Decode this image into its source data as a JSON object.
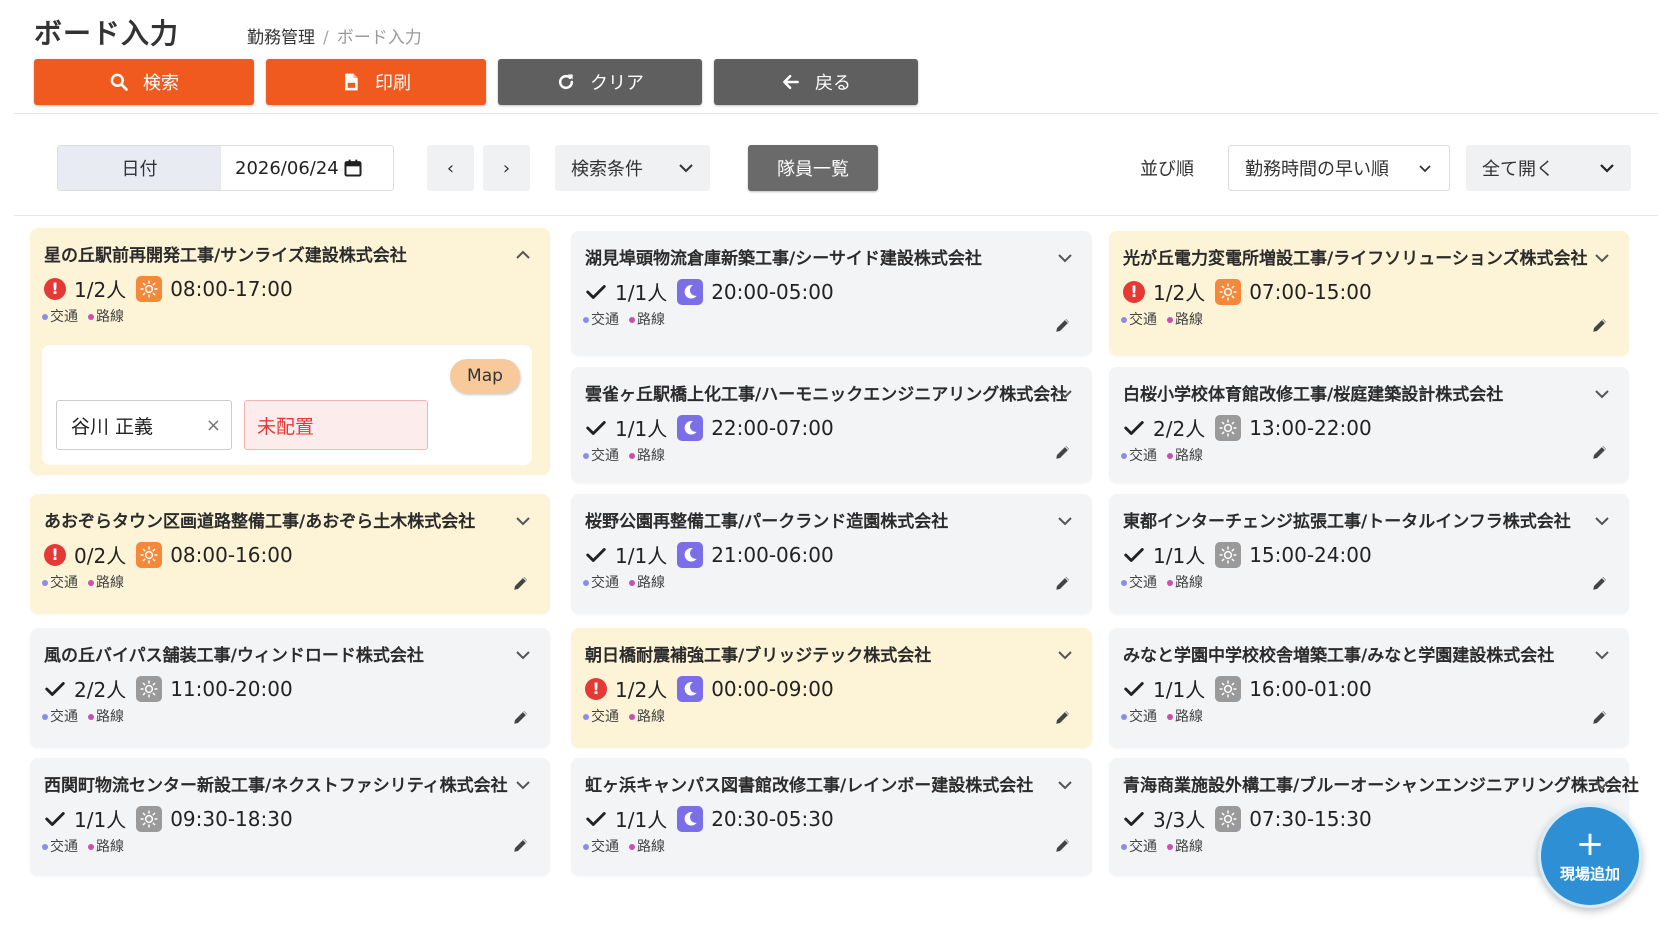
{
  "header": {
    "title": "ボード入力",
    "breadcrumb": [
      "勤務管理",
      "ボード入力"
    ],
    "separator": "/"
  },
  "toolbar": {
    "search": "検索",
    "print": "印刷",
    "clear": "クリア",
    "back": "戻る"
  },
  "filters": {
    "date_label": "日付",
    "date_value": "2026/06/24",
    "prev": "‹",
    "next": "›",
    "search_conditions": "検索条件",
    "members_list": "隊員一覧",
    "sort_label": "並び順",
    "sort_value": "勤務時間の早い順",
    "expand_value": "全て開く"
  },
  "tags": {
    "traffic": "交通",
    "route": "路線"
  },
  "colors": {
    "accent_orange": "#f15a1f",
    "warn_bg": "#fdf3d6",
    "alert": "#e53935",
    "sun": "#f5893b",
    "moon": "#7b6ee6",
    "fab": "#2f8fd4"
  },
  "detail": {
    "map": "Map",
    "assignee": "谷川 正義",
    "remove": "×",
    "unassigned": "未配置"
  },
  "cards": [
    {
      "title": "星の丘駅前再開発工事/サンライズ建設株式会社",
      "count": "1/2人",
      "time": "08:00-17:00",
      "status": "alert",
      "shift": "sun",
      "expanded": true
    },
    {
      "title": "湖見埠頭物流倉庫新築工事/シーサイド建設株式会社",
      "count": "1/1人",
      "time": "20:00-05:00",
      "status": "ok",
      "shift": "moon"
    },
    {
      "title": "光が丘電力変電所増設工事/ライフソリューションズ株式会社",
      "count": "1/2人",
      "time": "07:00-15:00",
      "status": "alert",
      "shift": "sun"
    },
    {
      "title": "雲雀ヶ丘駅橋上化工事/ハーモニックエンジニアリング株式会社",
      "count": "1/1人",
      "time": "22:00-07:00",
      "status": "ok",
      "shift": "moon"
    },
    {
      "title": "白桜小学校体育館改修工事/桜庭建築設計株式会社",
      "count": "2/2人",
      "time": "13:00-22:00",
      "status": "ok",
      "shift": "grey"
    },
    {
      "title": "あおぞらタウン区画道路整備工事/あおぞら土木株式会社",
      "count": "0/2人",
      "time": "08:00-16:00",
      "status": "alert",
      "shift": "sun"
    },
    {
      "title": "桜野公園再整備工事/パークランド造園株式会社",
      "count": "1/1人",
      "time": "21:00-06:00",
      "status": "ok",
      "shift": "moon"
    },
    {
      "title": "東都インターチェンジ拡張工事/トータルインフラ株式会社",
      "count": "1/1人",
      "time": "15:00-24:00",
      "status": "ok",
      "shift": "grey"
    },
    {
      "title": "風の丘バイパス舗装工事/ウィンドロード株式会社",
      "count": "2/2人",
      "time": "11:00-20:00",
      "status": "ok",
      "shift": "grey"
    },
    {
      "title": "朝日橋耐震補強工事/ブリッジテック株式会社",
      "count": "1/2人",
      "time": "00:00-09:00",
      "status": "alert",
      "shift": "moon"
    },
    {
      "title": "みなと学園中学校校舎増築工事/みなと学園建設株式会社",
      "count": "1/1人",
      "time": "16:00-01:00",
      "status": "ok",
      "shift": "grey"
    },
    {
      "title": "西関町物流センター新設工事/ネクストファシリティ株式会社",
      "count": "1/1人",
      "time": "09:30-18:30",
      "status": "ok",
      "shift": "grey"
    },
    {
      "title": "虹ヶ浜キャンパス図書館改修工事/レインボー建設株式会社",
      "count": "1/1人",
      "time": "20:30-05:30",
      "status": "ok",
      "shift": "moon"
    },
    {
      "title": "青海商業施設外構工事/ブルーオーシャンエンジニアリング株式会社",
      "count": "3/3人",
      "time": "07:30-15:30",
      "status": "ok",
      "shift": "grey"
    }
  ],
  "fab": {
    "plus": "+",
    "label": "現場追加"
  }
}
